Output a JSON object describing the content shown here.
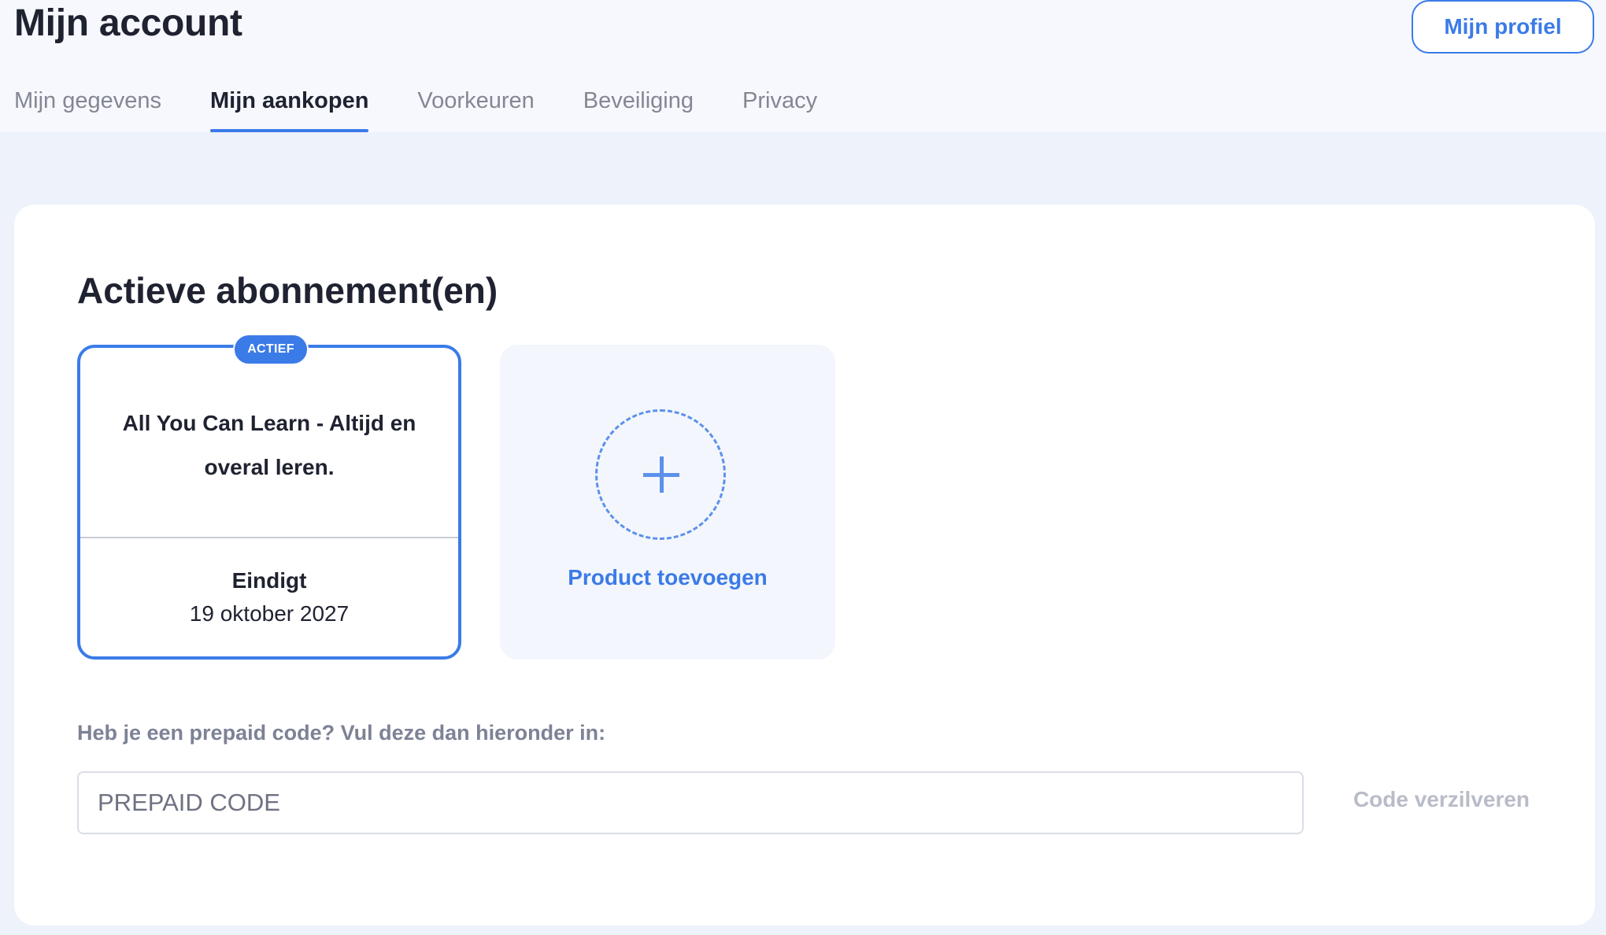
{
  "header": {
    "title": "Mijn account",
    "profile_button": "Mijn profiel"
  },
  "tabs": [
    {
      "label": "Mijn gegevens",
      "active": false
    },
    {
      "label": "Mijn aankopen",
      "active": true
    },
    {
      "label": "Voorkeuren",
      "active": false
    },
    {
      "label": "Beveiliging",
      "active": false
    },
    {
      "label": "Privacy",
      "active": false
    }
  ],
  "subscriptions": {
    "section_title": "Actieve abonnement(en)",
    "items": [
      {
        "badge": "ACTIEF",
        "name": "All You Can Learn - Altijd en overal leren.",
        "ends_label": "Eindigt",
        "ends_date": "19 oktober 2027"
      }
    ],
    "add_product": {
      "label": "Product toevoegen",
      "icon": "plus-icon"
    }
  },
  "prepaid": {
    "label": "Heb je een prepaid code? Vul deze dan hieronder in:",
    "placeholder": "PREPAID CODE",
    "value": "",
    "redeem_button": "Code verzilveren"
  },
  "colors": {
    "accent": "#3b7be8",
    "background": "#eef2fb",
    "header_background": "#f6f8fd",
    "muted_text": "#848694",
    "disabled_text": "#b9bcc8"
  }
}
